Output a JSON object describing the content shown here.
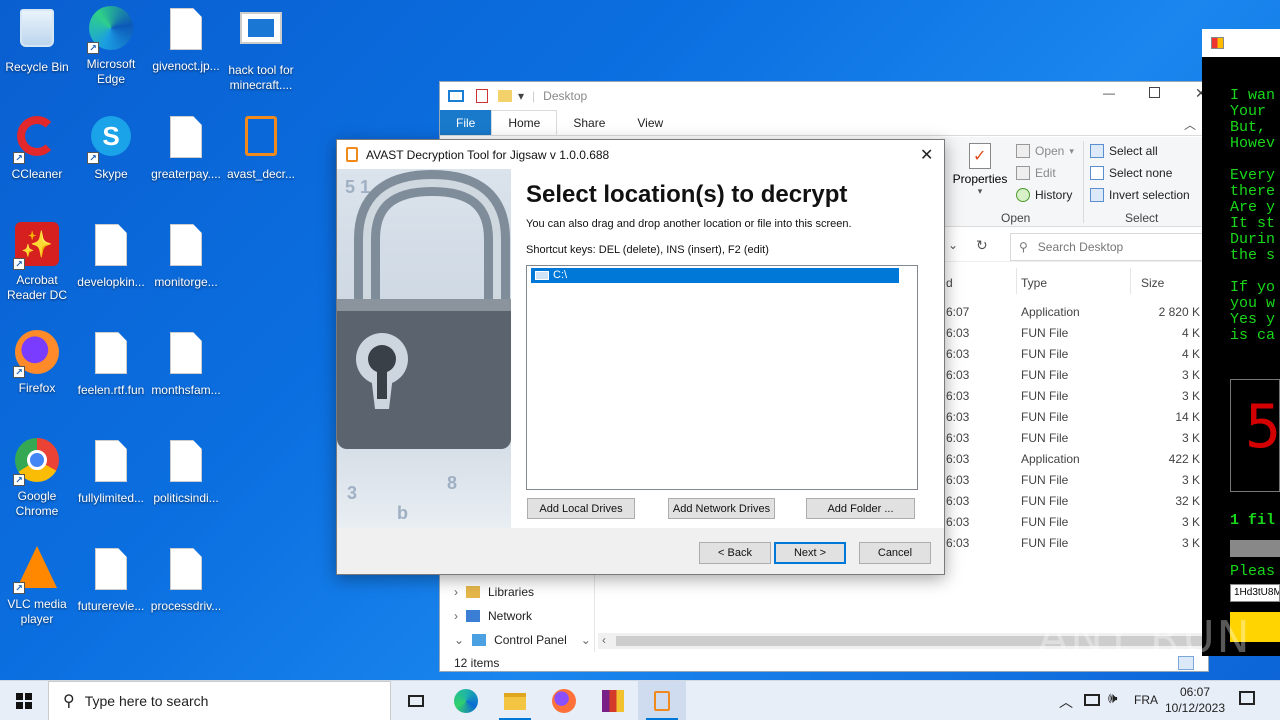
{
  "desktop_icons": [
    {
      "label": "Recycle Bin",
      "icon": "recycle-bin-icon"
    },
    {
      "label": "Microsoft Edge",
      "icon": "edge-icon"
    },
    {
      "label": "givenoct.jp...",
      "icon": "document-icon"
    },
    {
      "label": "hack tool for minecraft....",
      "icon": "window-app-icon"
    },
    {
      "label": "CCleaner",
      "icon": "ccleaner-icon"
    },
    {
      "label": "Skype",
      "icon": "skype-icon"
    },
    {
      "label": "greaterpay....",
      "icon": "document-icon"
    },
    {
      "label": "avast_decr...",
      "icon": "avast-lock-icon"
    },
    {
      "label": "Acrobat Reader DC",
      "icon": "acrobat-icon"
    },
    {
      "label": "developkin...",
      "icon": "document-icon"
    },
    {
      "label": "monitorge...",
      "icon": "document-icon"
    },
    {
      "label": "Firefox",
      "icon": "firefox-icon"
    },
    {
      "label": "feelen.rtf.fun",
      "icon": "document-icon"
    },
    {
      "label": "monthsfam...",
      "icon": "document-icon"
    },
    {
      "label": "Google Chrome",
      "icon": "chrome-icon"
    },
    {
      "label": "fullylimited...",
      "icon": "document-icon"
    },
    {
      "label": "politicsindi...",
      "icon": "document-icon"
    },
    {
      "label": "VLC media player",
      "icon": "vlc-icon"
    },
    {
      "label": "futurerevie...",
      "icon": "document-icon"
    },
    {
      "label": "processdriv...",
      "icon": "document-icon"
    }
  ],
  "explorer": {
    "title": "Desktop",
    "tabs": [
      "File",
      "Home",
      "Share",
      "View"
    ],
    "ribbon": {
      "properties": "Properties",
      "open": "Open",
      "edit": "Edit",
      "history": "History",
      "open_group": "Open",
      "select_all": "Select all",
      "select_none": "Select none",
      "invert_selection": "Invert selection",
      "select_group": "Select"
    },
    "search_placeholder": "Search Desktop",
    "columns": {
      "date_fragment": "d",
      "type": "Type",
      "size": "Size"
    },
    "rows": [
      {
        "time": "6:07",
        "type": "Application",
        "size": "2 820 K"
      },
      {
        "time": "6:03",
        "type": "FUN File",
        "size": "4 K"
      },
      {
        "time": "6:03",
        "type": "FUN File",
        "size": "4 K"
      },
      {
        "time": "6:03",
        "type": "FUN File",
        "size": "3 K"
      },
      {
        "time": "6:03",
        "type": "FUN File",
        "size": "3 K"
      },
      {
        "time": "6:03",
        "type": "FUN File",
        "size": "14 K"
      },
      {
        "time": "6:03",
        "type": "FUN File",
        "size": "3 K"
      },
      {
        "time": "6:03",
        "type": "Application",
        "size": "422 K"
      },
      {
        "time": "6:03",
        "type": "FUN File",
        "size": "3 K"
      },
      {
        "time": "6:03",
        "type": "FUN File",
        "size": "32 K"
      },
      {
        "time": "6:03",
        "type": "FUN File",
        "size": "3 K"
      },
      {
        "time": "6:03",
        "type": "FUN File",
        "size": "3 K"
      }
    ],
    "nav": [
      "Libraries",
      "Network",
      "Control Panel"
    ],
    "status": "12 items"
  },
  "dialog": {
    "title": "AVAST Decryption Tool for Jigsaw v 1.0.0.688",
    "heading": "Select location(s) to decrypt",
    "subheading": "You can also drag and drop another location or file into this screen.",
    "shortcuts": "Shortcut keys: DEL (delete), INS (insert), F2 (edit)",
    "locations": [
      "C:\\"
    ],
    "add_local": "Add Local Drives",
    "add_network": "Add Network Drives",
    "add_folder": "Add Folder ...",
    "back": "< Back",
    "next": "Next >",
    "cancel": "Cancel"
  },
  "ransom": {
    "lines_top": [
      "I wan",
      "Your",
      "But,",
      "Howev"
    ],
    "lines_mid": [
      "Every",
      "there",
      "Are y",
      "It st",
      "Durin",
      "the s"
    ],
    "lines_bot": [
      "If yo",
      "you w",
      "Yes y",
      "is ca"
    ],
    "counter": "5",
    "files_line": "1 fil",
    "please_line": "Pleas",
    "address": "1Hd3tU8M"
  },
  "taskbar": {
    "search_placeholder": "Type here to search",
    "language": "FRA",
    "time": "06:07",
    "date": "10/12/2023"
  },
  "watermark": "ANY RUN"
}
